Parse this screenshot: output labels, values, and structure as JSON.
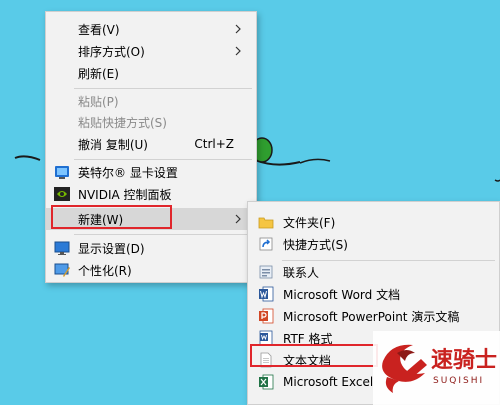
{
  "context_menu": {
    "items": [
      {
        "label": "查看(V)"
      },
      {
        "label": "排序方式(O)"
      },
      {
        "label": "刷新(E)"
      },
      {
        "label": "粘贴(P)"
      },
      {
        "label": "粘贴快捷方式(S)"
      },
      {
        "label": "撤消 复制(U)",
        "shortcut": "Ctrl+Z"
      },
      {
        "label": "英特尔® 显卡设置",
        "icon": "intel-graphics-icon"
      },
      {
        "label": "NVIDIA 控制面板",
        "icon": "nvidia-icon"
      },
      {
        "label": "新建(W)"
      },
      {
        "label": "显示设置(D)",
        "icon": "display-settings-icon"
      },
      {
        "label": "个性化(R)",
        "icon": "personalize-icon"
      }
    ]
  },
  "new_submenu": {
    "items": [
      {
        "label": "文件夹(F)",
        "icon": "folder-icon"
      },
      {
        "label": "快捷方式(S)",
        "icon": "shortcut-icon"
      },
      {
        "label": "联系人",
        "icon": "contact-icon"
      },
      {
        "label": "Microsoft Word 文档",
        "icon": "word-icon"
      },
      {
        "label": "Microsoft PowerPoint 演示文稿",
        "icon": "powerpoint-icon"
      },
      {
        "label": "RTF 格式",
        "icon": "rtf-icon"
      },
      {
        "label": "文本文档",
        "icon": "text-document-icon"
      },
      {
        "label": "Microsoft Excel",
        "icon": "excel-icon"
      }
    ]
  },
  "watermark": {
    "text": "速骑士",
    "subtext": "SUQISHI"
  },
  "colors": {
    "desktop": "#59cbe8",
    "menu_bg": "#f2f2f2",
    "highlight": "#d7d7d7",
    "red_box": "#e0262c"
  }
}
